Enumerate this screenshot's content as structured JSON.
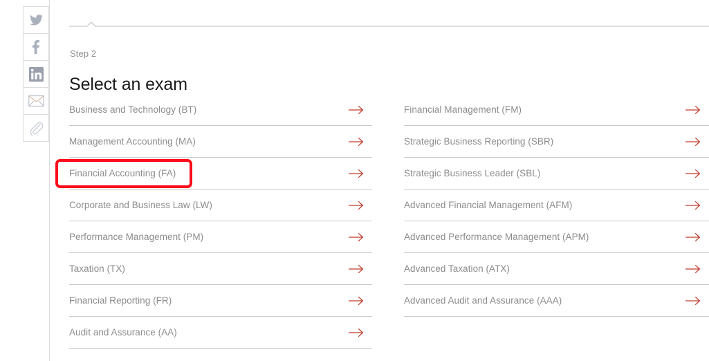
{
  "social_rail": {
    "items": [
      {
        "name": "twitter-icon",
        "label": "Twitter"
      },
      {
        "name": "facebook-icon",
        "label": "Facebook"
      },
      {
        "name": "linkedin-icon",
        "label": "LinkedIn"
      },
      {
        "name": "email-icon",
        "label": "Email"
      },
      {
        "name": "link-icon",
        "label": "Copy link"
      }
    ]
  },
  "header": {
    "step_label": "Step 2",
    "title": "Select an exam"
  },
  "colors": {
    "accent_arrow": "#c0392b",
    "highlight": "#fc0d1b",
    "text_muted": "#8c8c8c",
    "rule": "#c9c9c9",
    "icon_gray": "#a9b1bd"
  },
  "exam_list": {
    "arrow_icon": "arrow-right-icon",
    "left_column": [
      {
        "label": "Business and Technology (BT)",
        "code": "BT",
        "highlighted": false
      },
      {
        "label": "Management Accounting (MA)",
        "code": "MA",
        "highlighted": false
      },
      {
        "label": "Financial Accounting (FA)",
        "code": "FA",
        "highlighted": true
      },
      {
        "label": "Corporate and Business Law (LW)",
        "code": "LW",
        "highlighted": false
      },
      {
        "label": "Performance Management (PM)",
        "code": "PM",
        "highlighted": false
      },
      {
        "label": "Taxation (TX)",
        "code": "TX",
        "highlighted": false
      },
      {
        "label": "Financial Reporting (FR)",
        "code": "FR",
        "highlighted": false
      },
      {
        "label": "Audit and Assurance (AA)",
        "code": "AA",
        "highlighted": false
      }
    ],
    "right_column": [
      {
        "label": "Financial Management (FM)",
        "code": "FM",
        "highlighted": false
      },
      {
        "label": "Strategic Business Reporting (SBR)",
        "code": "SBR",
        "highlighted": false
      },
      {
        "label": "Strategic Business Leader (SBL)",
        "code": "SBL",
        "highlighted": false
      },
      {
        "label": "Advanced Financial Management (AFM)",
        "code": "AFM",
        "highlighted": false
      },
      {
        "label": "Advanced Performance Management (APM)",
        "code": "APM",
        "highlighted": false
      },
      {
        "label": "Advanced Taxation (ATX)",
        "code": "ATX",
        "highlighted": false
      },
      {
        "label": "Advanced Audit and Assurance (AAA)",
        "code": "AAA",
        "highlighted": false
      }
    ]
  }
}
